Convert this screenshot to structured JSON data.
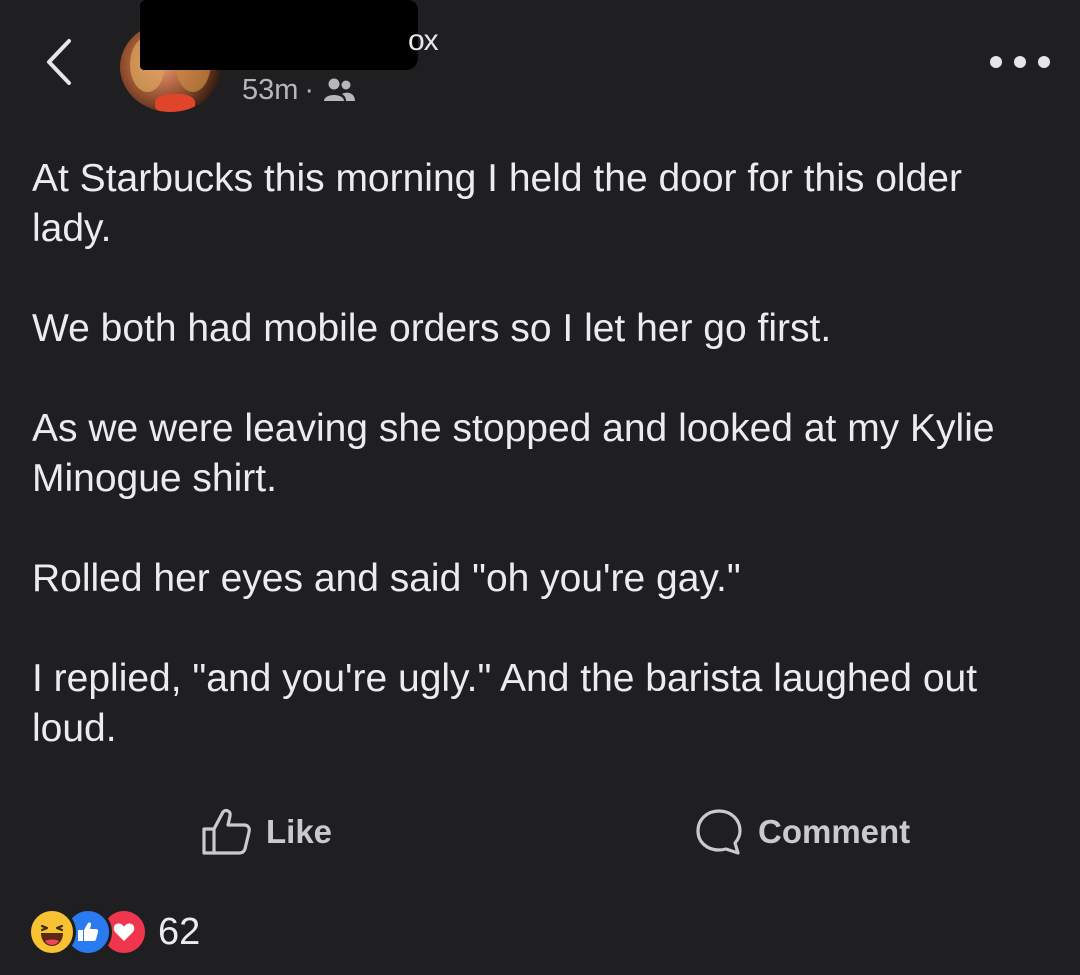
{
  "header": {
    "author_name_visible": "ox",
    "timestamp": "53m",
    "separator": "·",
    "audience_icon": "friends-icon",
    "back_icon": "chevron-left-icon",
    "more_icon": "more-horizontal-icon"
  },
  "post": {
    "paragraphs": [
      "At Starbucks this morning I held the door for this older lady.",
      "We both had mobile orders so I let her go first.",
      "As we were leaving she stopped and looked at my Kylie Minogue shirt.",
      "Rolled her eyes and said \"oh you're gay.\"",
      "I replied, \"and you're ugly.\" And the barista laughed out loud."
    ]
  },
  "actions": {
    "like_label": "Like",
    "like_icon": "thumbs-up-icon",
    "comment_label": "Comment",
    "comment_icon": "comment-bubble-icon"
  },
  "reactions": {
    "types": [
      "haha",
      "like",
      "love"
    ],
    "count": "62"
  },
  "colors": {
    "background": "#1f1e21",
    "text": "#ececee",
    "muted": "#b6b7bb",
    "like_blue": "#2a7bf0",
    "love_red": "#f0364f",
    "haha_yellow": "#f7c333"
  }
}
